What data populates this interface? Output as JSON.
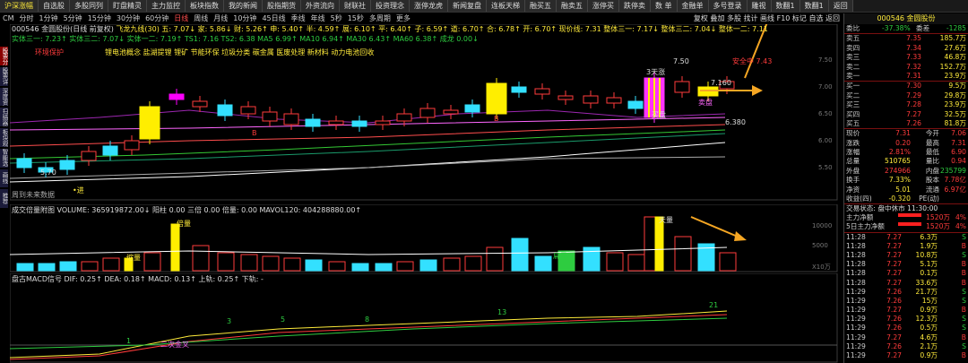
{
  "toolbar": [
    "沪深涨幅",
    "自选股",
    "多股同列",
    "盯盘精灵",
    "主力监控",
    "板块指数",
    "我的新闻",
    "股指期货",
    "外资流向",
    "财联社",
    "投资理念",
    "涨停龙虎",
    "新闻复盘",
    "连板天梯",
    "融买五",
    "融卖五",
    "涨停买",
    "跌停卖",
    "数 单",
    "金融单",
    "多号登录",
    "雕视",
    "数翻1",
    "数翻1",
    "返回"
  ],
  "periods": {
    "items": [
      "CM",
      "分时",
      "1分钟",
      "5分钟",
      "15分钟",
      "30分钟",
      "60分钟",
      "日线",
      "周线",
      "月线",
      "10分钟",
      "45日线",
      "季线",
      "年线",
      "5秒",
      "15秒",
      "多周期",
      "更多"
    ],
    "active": "日线",
    "right": "复权 叠加 多股 找计 画线 F10 标记 自选 返回"
  },
  "rail": [
    "股票分析",
    "股票详表",
    "深度资料",
    "扫描器",
    "板块观察",
    "智能选股",
    "画线",
    "推荐"
  ],
  "price_pane": {
    "line1": "000546 金圆股份(日线 前复权)",
    "line1b": "飞龙九线(30) 五: 7.07↓ 家: 5.86↓ 财: 5.26↑ 申: 5.40↑ 半: 4.59↑ 展: 6.10↑ 平: 6.40↑ 子: 6.59↑ 道: 6.70↑ 合: 6.78↑ 开: 6.70↑ 现价线: 7.31 整体三一: 7.17↓ 整体三二: 7.04↓ 整体一二: 7.11",
    "line2": "实体三一: 7.23↑ 实体三二: 7.07↓ 实体一二: 7.19↑ TS1: 7.16 TS2: 6.38 MA5 6.99↑ MA10 6.94↑ MA30 6.43↑ MA60 6.38↑ 成龙 0.00↓",
    "concept_tag": "环境保护",
    "concepts": "锂电池概念 盐湖提锂 锂矿 节能环保 垃圾分类 碳金属 医废处理 新材料 动力电池回收",
    "footer": "周到未来数据",
    "annotations": {
      "hi": "7.50",
      "t1": "7.160",
      "t2": "6.380",
      "low": "5.70",
      "zx": "安全中 7.43",
      "mp": "3天涨",
      "sell": "卖盘",
      "buy": "买盘",
      "dian": "•进",
      "a1": "B",
      "a2": "B"
    },
    "axis": [
      "7.50",
      "7.00",
      "6.50",
      "6.00",
      "5.50"
    ]
  },
  "vol_pane": {
    "line": "成交倍量附图 VOLUME: 365919872.00↓  阳柱 0.00  三倍 0.00  倍量: 0.00  MAVOL120: 404288880.00↑",
    "labels": {
      "l1": "倍量",
      "l2": "缩量",
      "l3": "天量",
      "l4": "扁量"
    },
    "axis": [
      "10000",
      "5000"
    ],
    "unit": "X10万"
  },
  "macd_pane": {
    "line": "盘古MACD信号 DIF: 0.25↑ DEA: 0.18↑ MACD: 0.13↑ 上轨: 0.25↑ 下轨: -",
    "nums": [
      "1",
      "3",
      "5",
      "8",
      "13",
      "21"
    ],
    "note": "二次金叉"
  },
  "quote": {
    "code": "000546 金圆股份",
    "weibi_label": "委比",
    "weibi": "-37.38%",
    "weicha_label": "委差",
    "weicha": "-1285",
    "asks": [
      [
        "卖五",
        "7.35",
        "185.7万"
      ],
      [
        "卖四",
        "7.34",
        "27.6万"
      ],
      [
        "卖三",
        "7.33",
        "46.8万"
      ],
      [
        "卖二",
        "7.32",
        "152.7万"
      ],
      [
        "卖一",
        "7.31",
        "23.9万"
      ]
    ],
    "bids": [
      [
        "买一",
        "7.30",
        "9.5万"
      ],
      [
        "买二",
        "7.29",
        "29.8万"
      ],
      [
        "买三",
        "7.28",
        "23.9万"
      ],
      [
        "买四",
        "7.27",
        "32.5万"
      ],
      [
        "买五",
        "7.26",
        "81.8万"
      ]
    ],
    "stats": [
      [
        "现价",
        "7.31",
        "今开",
        "7.06"
      ],
      [
        "涨跌",
        "0.20",
        "最高",
        "7.31"
      ],
      [
        "涨幅",
        "2.81%",
        "最低",
        "6.90"
      ],
      [
        "总量",
        "510765",
        "量比",
        "0.94"
      ],
      [
        "外盘",
        "274966",
        "内盘",
        "235799"
      ],
      [
        "换手",
        "7.33%",
        "股本",
        "7.78亿"
      ],
      [
        "净资",
        "5.01",
        "流通",
        "6.97亿"
      ],
      [
        "收益(四)",
        "-0.320",
        "PE(动)",
        ""
      ]
    ],
    "status": "交易状态: 盘中休市 11:30:00",
    "flow": [
      [
        "主力净额",
        "1520万",
        "4%"
      ],
      [
        "5日主力净额",
        "1520万",
        "4%"
      ]
    ],
    "ticks": [
      [
        "11:28",
        "7.27",
        "6.3万",
        "S"
      ],
      [
        "11:28",
        "7.27",
        "1.9万",
        "B"
      ],
      [
        "11:28",
        "7.27",
        "10.8万",
        "S"
      ],
      [
        "11:28",
        "7.27",
        "5.1万",
        "B"
      ],
      [
        "11:28",
        "7.27",
        "0.1万",
        "B"
      ],
      [
        "11:28",
        "7.27",
        "33.6万",
        "B"
      ],
      [
        "11:29",
        "7.26",
        "21.7万",
        "S"
      ],
      [
        "11:29",
        "7.26",
        "15万",
        "S"
      ],
      [
        "11:29",
        "7.27",
        "0.9万",
        "B"
      ],
      [
        "11:29",
        "7.26",
        "12.3万",
        "S"
      ],
      [
        "11:29",
        "7.26",
        "0.5万",
        "S"
      ],
      [
        "11:29",
        "7.27",
        "4.6万",
        "B"
      ],
      [
        "11:29",
        "7.26",
        "2.1万",
        "S"
      ],
      [
        "11:29",
        "7.27",
        "0.9万",
        "B"
      ]
    ]
  },
  "colors": {
    "up": "#ff3b3b",
    "down": "#33e0ff",
    "yellow": "#ffee00",
    "magenta": "#ff00ff",
    "ma_white": "#dddddd",
    "ma_green": "#34c934"
  }
}
